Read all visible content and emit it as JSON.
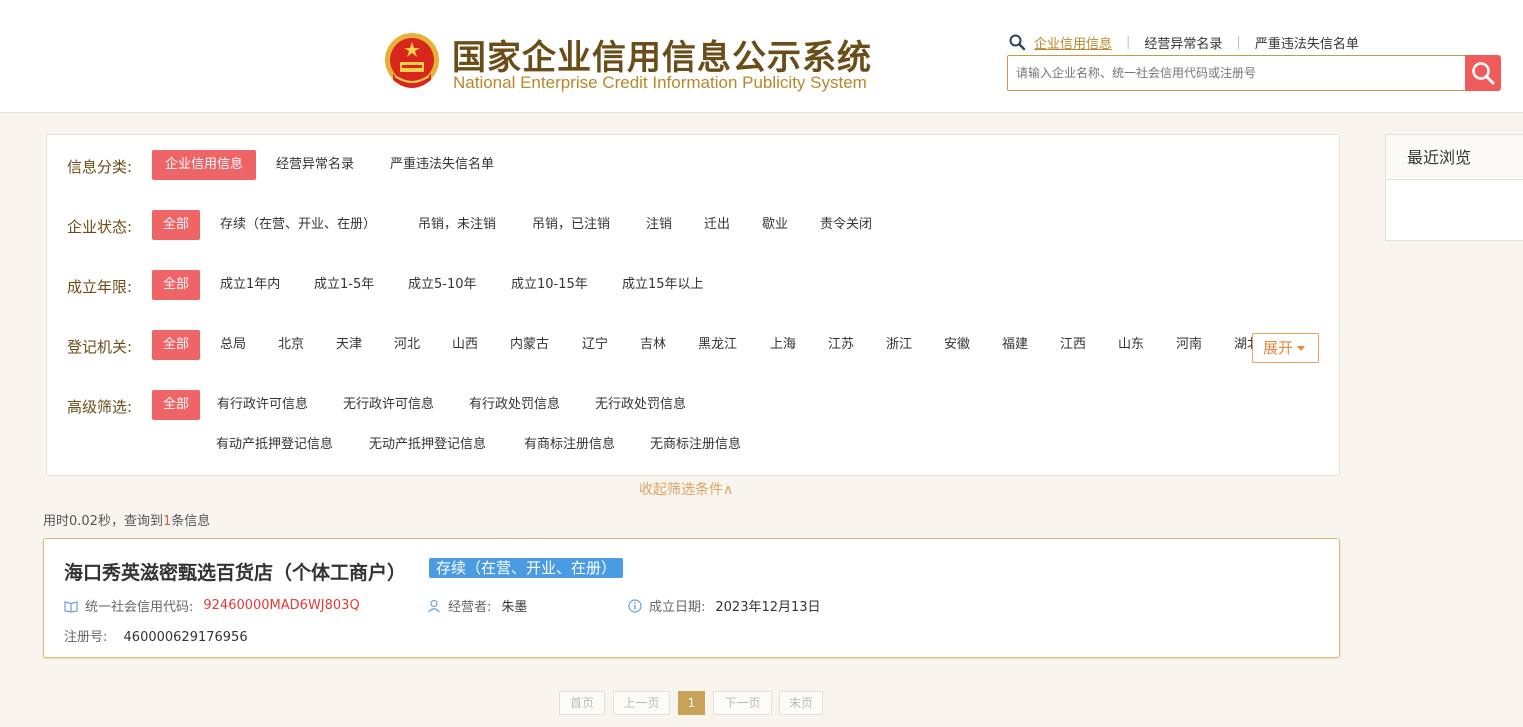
{
  "header": {
    "title_cn": "国家企业信用信息公示系统",
    "title_en": "National Enterprise Credit Information Publicity System",
    "links": [
      "企业信用信息",
      "经营异常名录",
      "严重违法失信名单"
    ],
    "search_placeholder": "请输入企业名称、统一社会信用代码或注册号"
  },
  "filters": {
    "category": {
      "label": "信息分类:",
      "options": [
        "企业信用信息",
        "经营异常名录",
        "严重违法失信名单"
      ]
    },
    "status": {
      "label": "企业状态:",
      "options": [
        "全部",
        "存续（在营、开业、在册）",
        "吊销，未注销",
        "吊销，已注销",
        "注销",
        "迁出",
        "歇业",
        "责令关闭"
      ]
    },
    "years": {
      "label": "成立年限:",
      "options": [
        "全部",
        "成立1年内",
        "成立1-5年",
        "成立5-10年",
        "成立10-15年",
        "成立15年以上"
      ]
    },
    "authority": {
      "label": "登记机关:",
      "options": [
        "全部",
        "总局",
        "北京",
        "天津",
        "河北",
        "山西",
        "内蒙古",
        "辽宁",
        "吉林",
        "黑龙江",
        "上海",
        "江苏",
        "浙江",
        "安徽",
        "福建",
        "江西",
        "山东",
        "河南",
        "湖北"
      ],
      "expand_label": "展开"
    },
    "advanced": {
      "label": "高级筛选:",
      "options_row1": [
        "全部",
        "有行政许可信息",
        "无行政许可信息",
        "有行政处罚信息",
        "无行政处罚信息"
      ],
      "options_row2": [
        "有动产抵押登记信息",
        "无动产抵押登记信息",
        "有商标注册信息",
        "无商标注册信息"
      ]
    },
    "collapse_label": "收起筛选条件∧"
  },
  "recent": {
    "title": "最近浏览"
  },
  "stats": {
    "prefix": "用时0.02秒，查询到",
    "count": "1",
    "suffix": "条信息"
  },
  "result": {
    "name": "海口秀英滋密甄选百货店（个体工商户）",
    "status": "存续（在营、开业、在册）",
    "credit_code_label": "统一社会信用代码:",
    "credit_code": "92460000MAD6WJ803Q",
    "operator_label": "经营者:",
    "operator": "朱墨",
    "date_label": "成立日期:",
    "date": "2023年12月13日",
    "reg_label": "注册号:",
    "reg_no": "460000629176956"
  },
  "pagination": {
    "first": "首页",
    "prev": "上一页",
    "current": "1",
    "next": "下一页",
    "last": "末页"
  },
  "colors": {
    "brand_brown": "#6b4d17",
    "accent_red": "#ef6467",
    "status_blue": "#4a9be2",
    "gold": "#c9a25a"
  }
}
